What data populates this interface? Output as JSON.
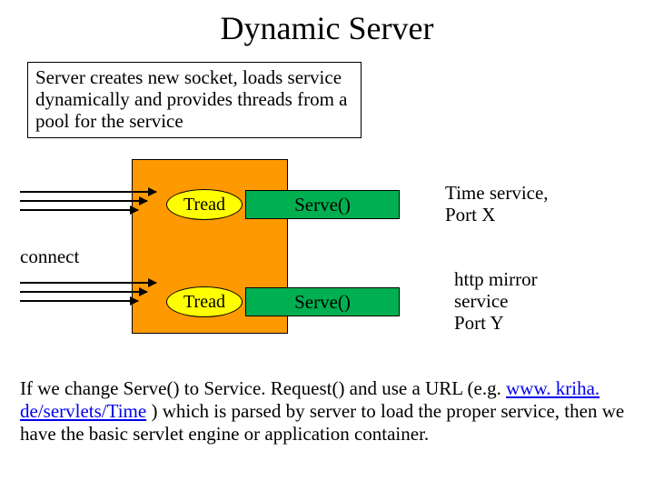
{
  "title": "Dynamic Server",
  "description": "Server creates new socket, loads service dynamically and provides threads from a pool for the service",
  "connect_label": "connect",
  "thread_label_1": "Tread",
  "thread_label_2": "Tread",
  "serve_label_1": "Serve()",
  "serve_label_2": "Serve()",
  "side1_line1": "Time service,",
  "side1_line2": "Port X",
  "side2_line1": "http mirror",
  "side2_line2": "service",
  "side2_line3": "Port Y",
  "bottom_pre": "If we change Serve() to Service. Request() and use a URL (e.g. ",
  "bottom_link": "www. kriha. de/servlets/Time",
  "bottom_post": " ) which is parsed by server to load the proper service, then we have the basic servlet engine or application container."
}
